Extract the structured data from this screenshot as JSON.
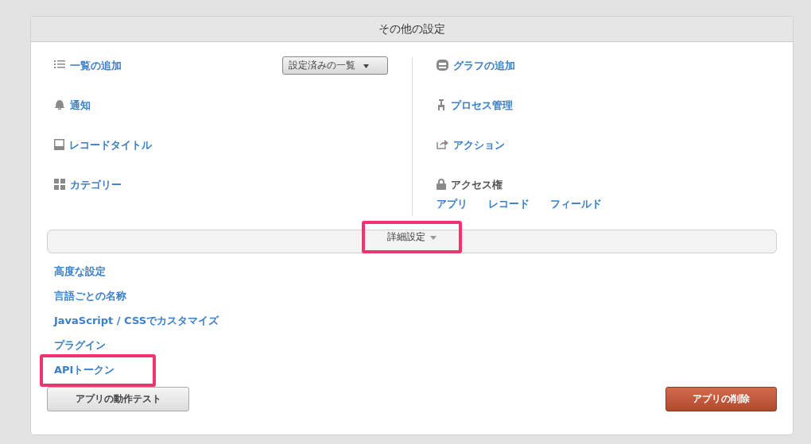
{
  "panel": {
    "title": "その他の設定"
  },
  "left_items": [
    {
      "label": "一覧の追加"
    },
    {
      "label": "通知"
    },
    {
      "label": "レコードタイトル"
    },
    {
      "label": "カテゴリー"
    }
  ],
  "list_dropdown": {
    "label": "設定済みの一覧"
  },
  "right_items": [
    {
      "label": "グラフの追加"
    },
    {
      "label": "プロセス管理"
    },
    {
      "label": "アクション"
    }
  ],
  "access": {
    "label": "アクセス権",
    "links": [
      "アプリ",
      "レコード",
      "フィールド"
    ]
  },
  "detail_toggle": {
    "label": "詳細設定",
    "highlighted": true
  },
  "advanced_links": [
    {
      "label": "高度な設定",
      "highlighted": false
    },
    {
      "label": "言語ごとの名称",
      "highlighted": false
    },
    {
      "label": "JavaScript / CSSでカスタマイズ",
      "highlighted": false
    },
    {
      "label": "プラグイン",
      "highlighted": false
    },
    {
      "label": "APIトークン",
      "highlighted": true
    }
  ],
  "buttons": {
    "test": "アプリの動作テスト",
    "delete": "アプリの削除"
  }
}
